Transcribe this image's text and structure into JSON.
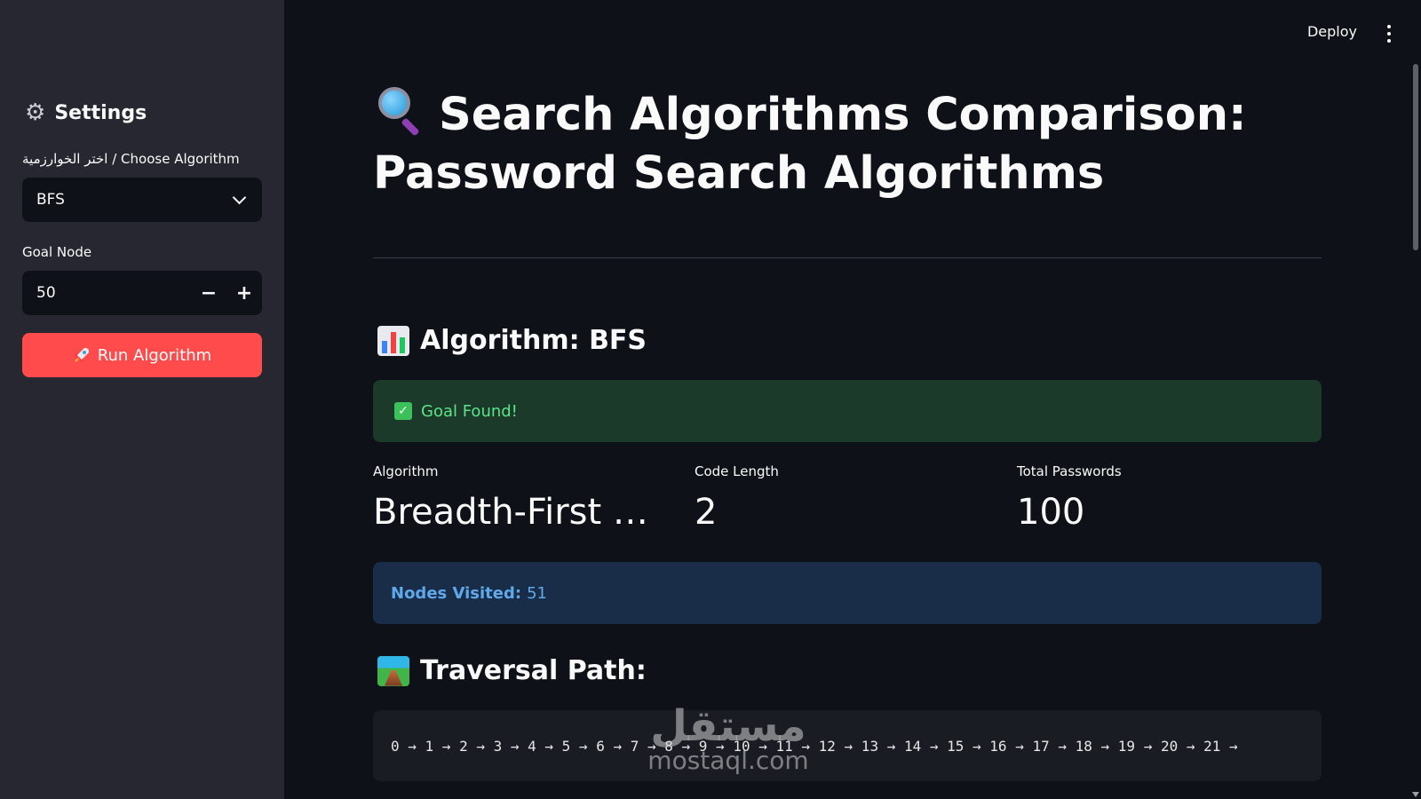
{
  "sidebar": {
    "title": "Settings",
    "title_icon": "gear-icon",
    "algorithm_label": "اختر الخوارزمية / Choose Algorithm",
    "algorithm_selected": "BFS",
    "goal_label": "Goal Node",
    "goal_value": "50",
    "decrement_label": "−",
    "increment_label": "+",
    "run_label": "Run Algorithm",
    "run_icon": "rocket-icon",
    "accent": "#ff4b4b"
  },
  "header": {
    "deploy_label": "Deploy"
  },
  "main": {
    "title_icon": "magnifying-glass-icon",
    "title": "Search Algorithms Comparison: Password Search Algorithms",
    "algorithm_heading": "Algorithm: BFS",
    "algorithm_heading_icon": "bar-chart-icon",
    "success_text": "Goal Found!",
    "metrics": [
      {
        "label": "Algorithm",
        "value": "Breadth-First S…"
      },
      {
        "label": "Code Length",
        "value": "2"
      },
      {
        "label": "Total Passwords",
        "value": "100"
      }
    ],
    "nodes_visited_label": "Nodes Visited:",
    "nodes_visited_value": "51",
    "path_heading": "Traversal Path:",
    "path_heading_icon": "railway-track-icon",
    "path_text": "0 → 1 → 2 → 3 → 4 → 5 → 6 → 7 → 8 → 9 → 10 → 11 → 12 → 13 → 14 → 15 → 16 → 17 → 18 → 19 → 20 → 21 →"
  },
  "watermark": {
    "arabic": "مستقل",
    "latin": "mostaql.com"
  }
}
